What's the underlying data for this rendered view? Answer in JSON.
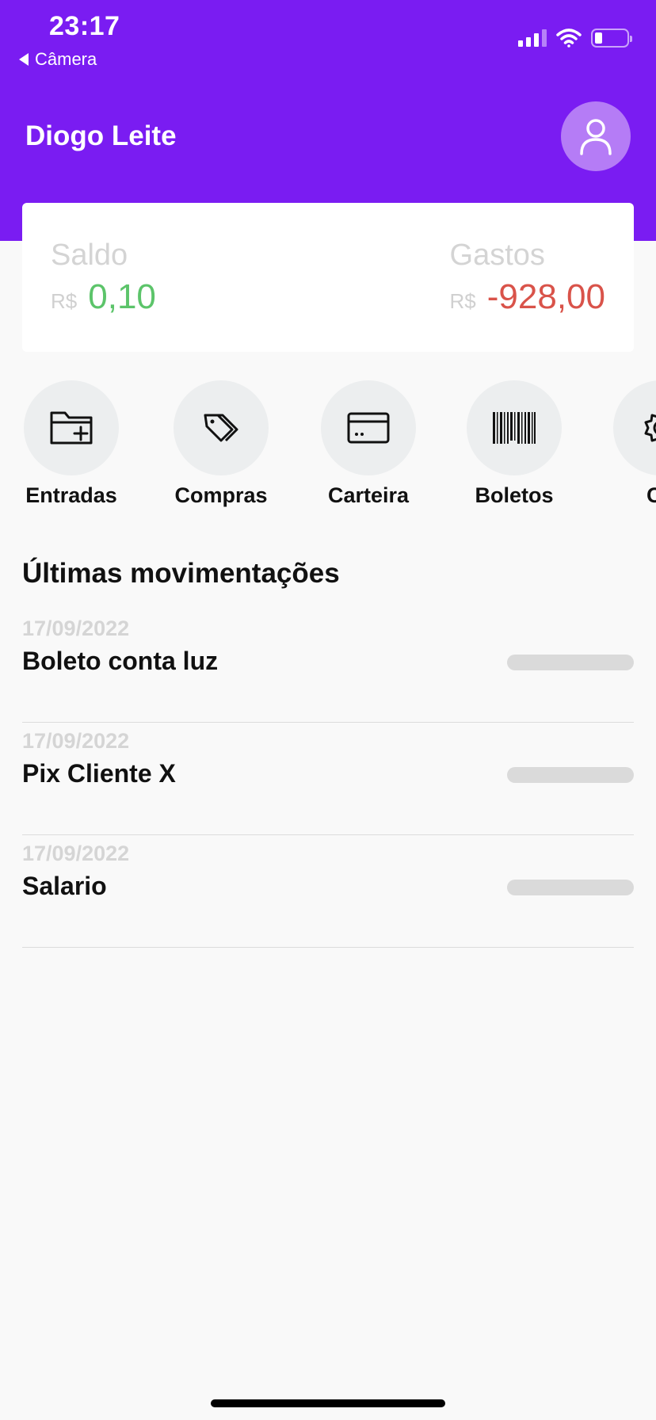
{
  "status_bar": {
    "time": "23:17",
    "back_label": "Câmera"
  },
  "header": {
    "user_name": "Diogo Leite",
    "accent_color": "#7a1cf2",
    "avatar_icon": "user-icon"
  },
  "balance_card": {
    "balance_label": "Saldo",
    "balance_currency": "R$",
    "balance_value": "0,10",
    "expenses_label": "Gastos",
    "expenses_currency": "R$",
    "expenses_value": "-928,00",
    "positive_color": "#5cc46a",
    "negative_color": "#d9534a"
  },
  "shortcuts": [
    {
      "label": "Entradas",
      "icon": "folder-plus-icon"
    },
    {
      "label": "Compras",
      "icon": "tag-icon"
    },
    {
      "label": "Carteira",
      "icon": "credit-card-icon"
    },
    {
      "label": "Boletos",
      "icon": "barcode-icon"
    },
    {
      "label": "Co",
      "icon": "gear-icon"
    }
  ],
  "movements": {
    "title": "Últimas movimentações",
    "items": [
      {
        "date": "17/09/2022",
        "description": "Boleto conta luz"
      },
      {
        "date": "17/09/2022",
        "description": "Pix Cliente X"
      },
      {
        "date": "17/09/2022",
        "description": "Salario"
      }
    ]
  }
}
